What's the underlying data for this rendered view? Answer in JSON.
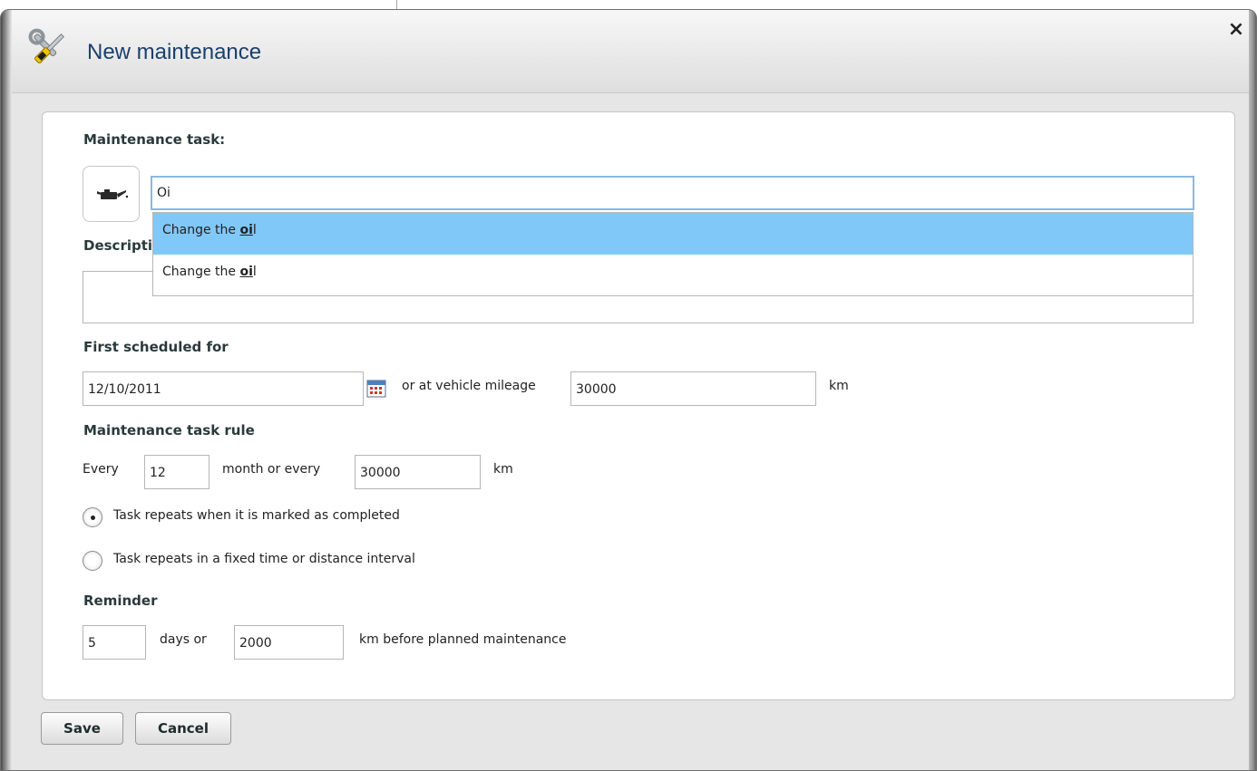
{
  "dialog": {
    "title": "New maintenance",
    "close_label": "×"
  },
  "form": {
    "task_label": "Maintenance task:",
    "task_value": "Oi",
    "suggestions": [
      {
        "prefix": "Change the ",
        "match": "oi",
        "suffix": "l"
      },
      {
        "prefix": "Change the ",
        "match": "oi",
        "suffix": "l"
      }
    ],
    "description_label": "Descripti",
    "first_scheduled_label": "First scheduled for",
    "first_date": "12/10/2011",
    "or_mileage_text": "or at vehicle mileage",
    "first_mileage": "30000",
    "km_unit": "km",
    "rule_label": "Maintenance task rule",
    "every_text": "Every",
    "months_value": "12",
    "month_or_every_text": "month or every",
    "rule_mileage": "30000",
    "radio_completed_label": "Task repeats when it is marked as completed",
    "radio_fixed_label": "Task repeats in a fixed time or distance interval",
    "reminder_label": "Reminder",
    "reminder_days": "5",
    "days_or_text": "days or",
    "reminder_km": "2000",
    "km_before_text": "km before planned maintenance"
  },
  "buttons": {
    "save": "Save",
    "cancel": "Cancel"
  },
  "icons": {
    "header": "wrench-screwdriver-icon",
    "task": "oil-can-icon",
    "calendar": "calendar-icon"
  },
  "colors": {
    "title": "#1a3f6e",
    "highlight": "#80c8f8",
    "focus_border": "#86b9e6"
  },
  "state": {
    "selected_radio": "completed",
    "highlighted_suggestion": 0
  }
}
